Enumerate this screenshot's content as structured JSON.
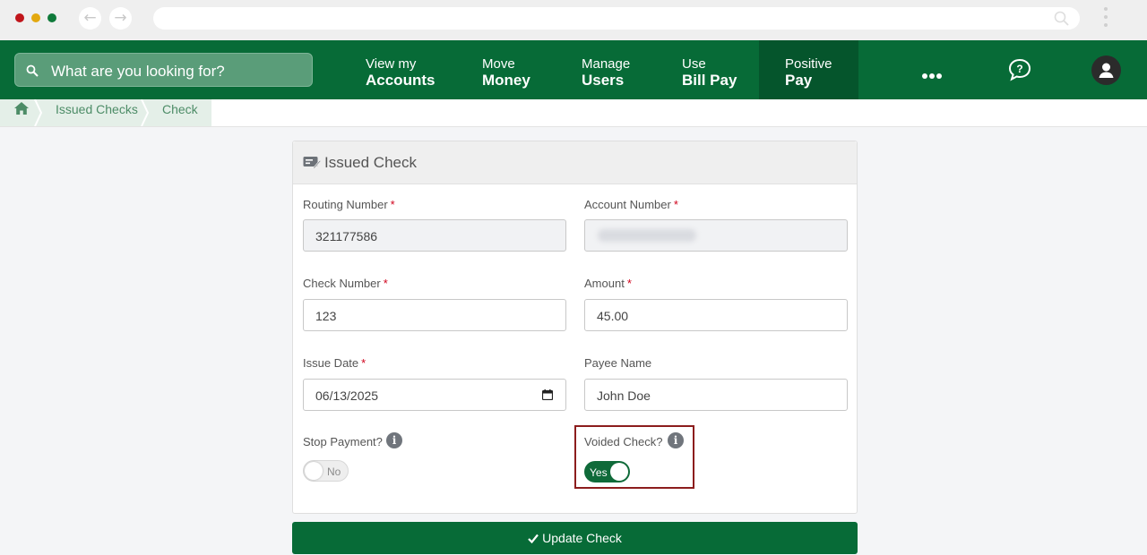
{
  "search": {
    "placeholder": "What are you looking for?"
  },
  "nav": [
    {
      "line1": "View my",
      "line2": "Accounts"
    },
    {
      "line1": "Move",
      "line2": "Money"
    },
    {
      "line1": "Manage",
      "line2": "Users"
    },
    {
      "line1": "Use",
      "line2": "Bill Pay"
    },
    {
      "line1": "Positive",
      "line2": "Pay"
    }
  ],
  "breadcrumb": {
    "items": [
      "Issued Checks",
      "Check"
    ]
  },
  "card": {
    "title": "Issued Check",
    "fields": {
      "routing": {
        "label": "Routing Number",
        "value": "321177586"
      },
      "account": {
        "label": "Account Number"
      },
      "check_number": {
        "label": "Check Number",
        "value": "123"
      },
      "amount": {
        "label": "Amount",
        "value": "45.00"
      },
      "issue_date": {
        "label": "Issue Date",
        "value": "06/13/2025"
      },
      "payee": {
        "label": "Payee Name",
        "value": "John Doe"
      }
    },
    "required_mark": "*",
    "stop_payment": {
      "label": "Stop Payment?",
      "state": "No"
    },
    "voided_check": {
      "label": "Voided Check?",
      "state": "Yes"
    }
  },
  "update_button": {
    "label": "Update Check"
  },
  "colors": {
    "brand_green": "#076b37",
    "active_nav": "#05552c",
    "required": "#d0021b",
    "highlight": "#8c1d1d"
  }
}
